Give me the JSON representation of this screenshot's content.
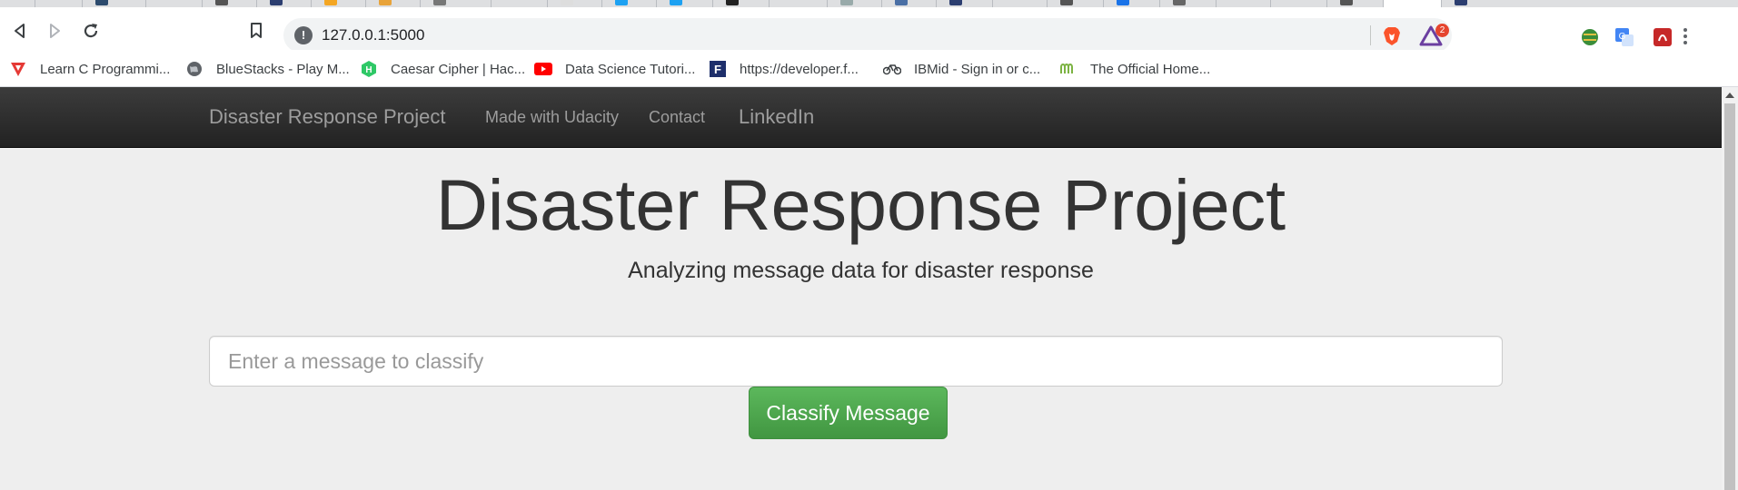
{
  "browser": {
    "url": "127.0.0.1:5000",
    "rewards_count": "2",
    "bookmarks": [
      {
        "label": "Learn C Programmi...",
        "icon": "tutorial-v-icon"
      },
      {
        "label": "BlueStacks - Play M...",
        "icon": "globe-icon"
      },
      {
        "label": "Caesar Cipher | Hac...",
        "icon": "hackerrank-icon"
      },
      {
        "label": "Data Science Tutori...",
        "icon": "youtube-icon"
      },
      {
        "label": "https://developer.f...",
        "icon": "f-square-icon"
      },
      {
        "label": "IBMid - Sign in or c...",
        "icon": "ibm-bike-icon"
      },
      {
        "label": "The Official Home...",
        "icon": "mm-logo-icon"
      }
    ]
  },
  "navbar": {
    "brand": "Disaster Response Project",
    "links": [
      "Made with Udacity",
      "Contact",
      "LinkedIn"
    ]
  },
  "jumbotron": {
    "title": "Disaster Response Project",
    "subtitle": "Analyzing message data for disaster response"
  },
  "form": {
    "placeholder": "Enter a message to classify",
    "button_label": "Classify Message"
  },
  "colors": {
    "navbar_bg": "#222222",
    "button_green": "#5cb85c",
    "page_bg": "#eeeeee",
    "brave_orange": "#fb542b"
  }
}
